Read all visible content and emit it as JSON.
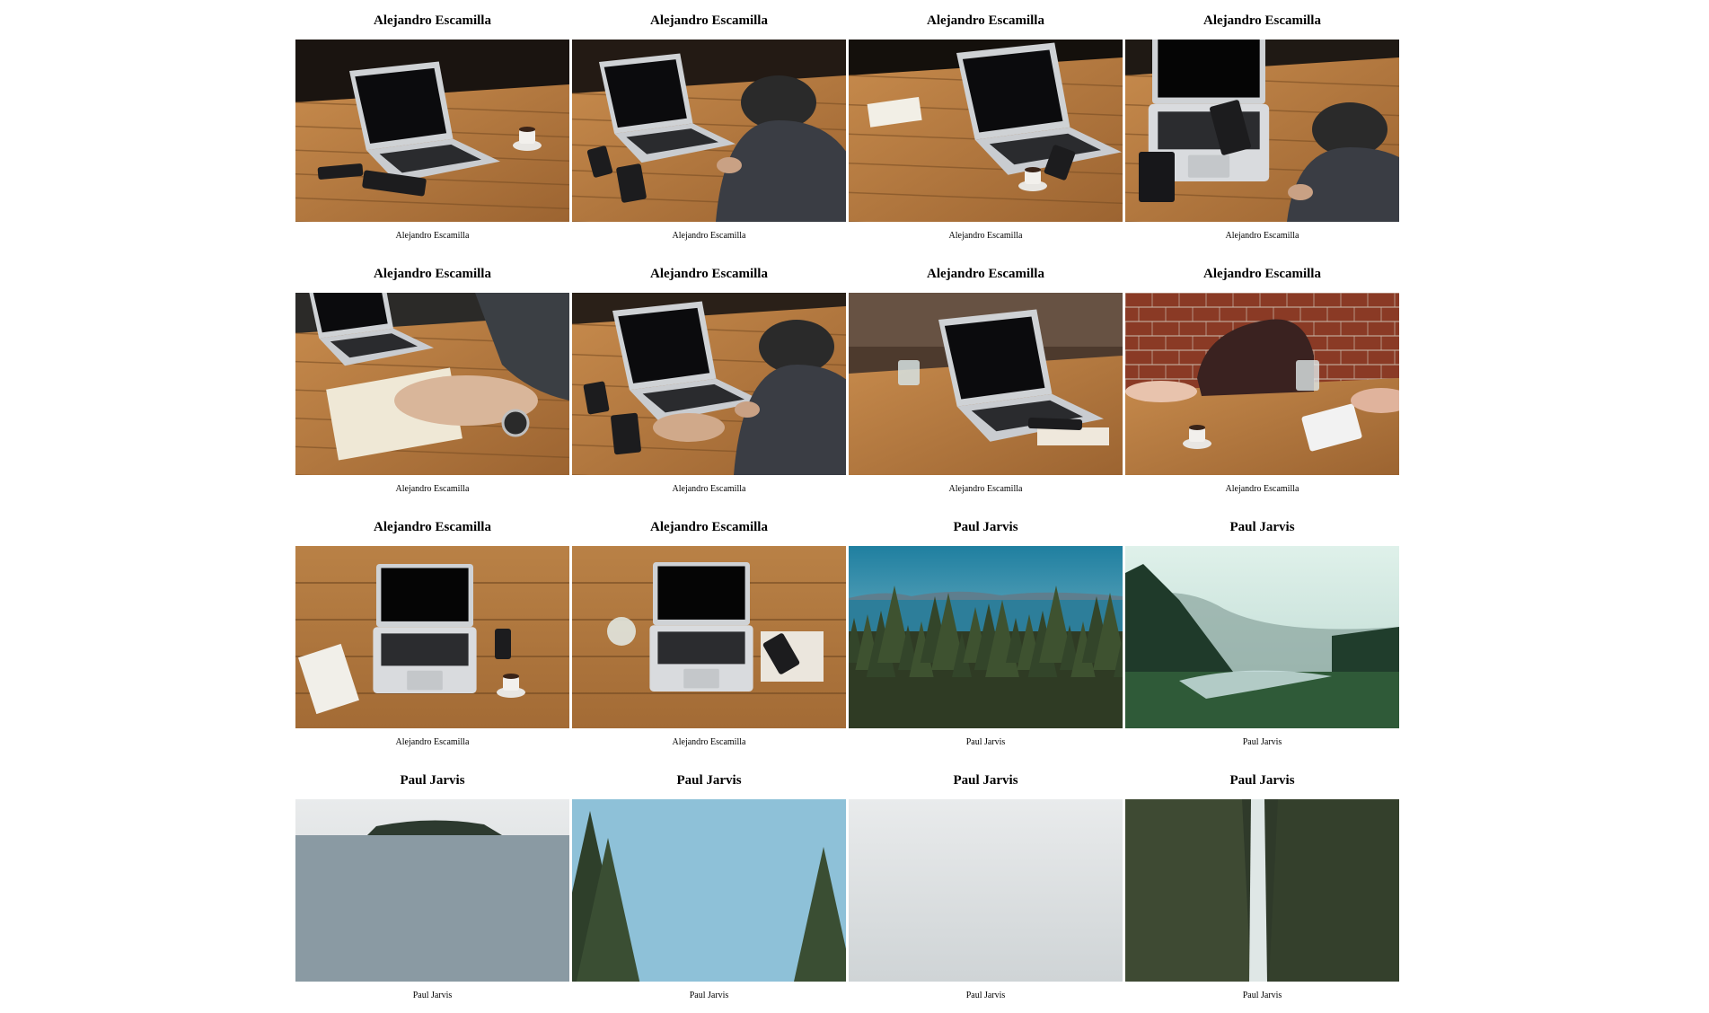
{
  "gallery": {
    "items": [
      {
        "title": "Alejandro Escamilla",
        "caption": "Alejandro Escamilla",
        "scene": "laptop-side-cup"
      },
      {
        "title": "Alejandro Escamilla",
        "caption": "Alejandro Escamilla",
        "scene": "person-typing"
      },
      {
        "title": "Alejandro Escamilla",
        "caption": "Alejandro Escamilla",
        "scene": "laptop-notebook-cup"
      },
      {
        "title": "Alejandro Escamilla",
        "caption": "Alejandro Escamilla",
        "scene": "hand-phone-laptop"
      },
      {
        "title": "Alejandro Escamilla",
        "caption": "Alejandro Escamilla",
        "scene": "writing-notebook-watch"
      },
      {
        "title": "Alejandro Escamilla",
        "caption": "Alejandro Escamilla",
        "scene": "person-typing-front"
      },
      {
        "title": "Alejandro Escamilla",
        "caption": "Alejandro Escamilla",
        "scene": "laptop-glass-outdoor"
      },
      {
        "title": "Alejandro Escamilla",
        "caption": "Alejandro Escamilla",
        "scene": "table-bag-brick-wall"
      },
      {
        "title": "Alejandro Escamilla",
        "caption": "Alejandro Escamilla",
        "scene": "laptop-top-notebook-cup"
      },
      {
        "title": "Alejandro Escamilla",
        "caption": "Alejandro Escamilla",
        "scene": "laptop-top-glass-phone"
      },
      {
        "title": "Paul Jarvis",
        "caption": "Paul Jarvis",
        "scene": "forest-lake-mountains"
      },
      {
        "title": "Paul Jarvis",
        "caption": "Paul Jarvis",
        "scene": "misty-river-valley"
      },
      {
        "title": "Paul Jarvis",
        "caption": "Paul Jarvis",
        "scene": "lake-island-overcast"
      },
      {
        "title": "Paul Jarvis",
        "caption": "Paul Jarvis",
        "scene": "pine-trees-sky"
      },
      {
        "title": "Paul Jarvis",
        "caption": "Paul Jarvis",
        "scene": "pale-sky"
      },
      {
        "title": "Paul Jarvis",
        "caption": "Paul Jarvis",
        "scene": "waterfall-forest"
      }
    ]
  },
  "colors": {
    "page_background": "#ffffff",
    "wood": "#b5793f",
    "dark_background": "#1a1410",
    "laptop_silver": "#d6d8da"
  }
}
